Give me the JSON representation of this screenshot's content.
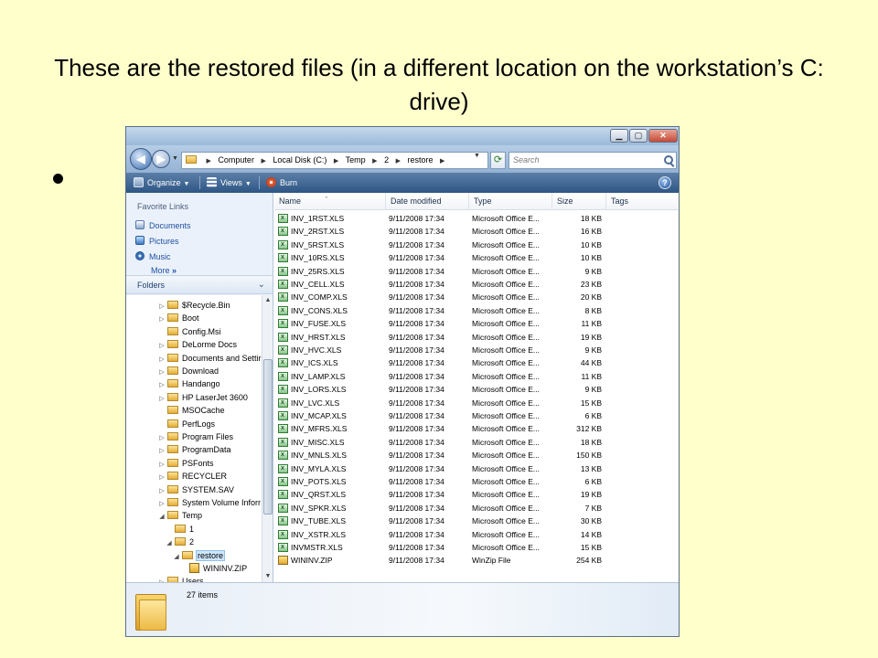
{
  "slide": {
    "title": "These are the restored files (in a different location on the workstation’s C: drive)"
  },
  "window": {
    "address": {
      "crumbs": [
        "Computer",
        "Local Disk (C:)",
        "Temp",
        "2",
        "restore"
      ]
    },
    "search_placeholder": "Search",
    "toolbar": {
      "organize": "Organize",
      "views": "Views",
      "burn": "Burn"
    },
    "nav": {
      "favorite_links_title": "Favorite Links",
      "favorites": [
        "Documents",
        "Pictures",
        "Music"
      ],
      "more_label": "More",
      "folders_title": "Folders",
      "tree": [
        {
          "label": "$Recycle.Bin",
          "level": 0,
          "expander": "▷"
        },
        {
          "label": "Boot",
          "level": 0,
          "expander": "▷"
        },
        {
          "label": "Config.Msi",
          "level": 0,
          "expander": ""
        },
        {
          "label": "DeLorme Docs",
          "level": 0,
          "expander": "▷"
        },
        {
          "label": "Documents and Settir",
          "level": 0,
          "expander": "▷"
        },
        {
          "label": "Download",
          "level": 0,
          "expander": "▷"
        },
        {
          "label": "Handango",
          "level": 0,
          "expander": "▷"
        },
        {
          "label": "HP LaserJet 3600",
          "level": 0,
          "expander": "▷"
        },
        {
          "label": "MSOCache",
          "level": 0,
          "expander": ""
        },
        {
          "label": "PerfLogs",
          "level": 0,
          "expander": ""
        },
        {
          "label": "Program Files",
          "level": 0,
          "expander": "▷"
        },
        {
          "label": "ProgramData",
          "level": 0,
          "expander": "▷"
        },
        {
          "label": "PSFonts",
          "level": 0,
          "expander": "▷"
        },
        {
          "label": "RECYCLER",
          "level": 0,
          "expander": "▷"
        },
        {
          "label": "SYSTEM.SAV",
          "level": 0,
          "expander": "▷"
        },
        {
          "label": "System Volume Inforr",
          "level": 0,
          "expander": "▷"
        },
        {
          "label": "Temp",
          "level": 0,
          "expander": "◢"
        },
        {
          "label": "1",
          "level": 1,
          "expander": ""
        },
        {
          "label": "2",
          "level": 1,
          "expander": "◢"
        },
        {
          "label": "restore",
          "level": 2,
          "expander": "◢",
          "selected": true
        },
        {
          "label": "WININV.ZIP",
          "level": 3,
          "expander": "",
          "zip": true
        },
        {
          "label": "Users",
          "level": 0,
          "expander": "▷"
        }
      ]
    },
    "columns": [
      "Name",
      "Date modified",
      "Type",
      "Size",
      "Tags"
    ],
    "files": [
      {
        "name": "INV_1RST.XLS",
        "date": "9/11/2008 17:34",
        "type": "Microsoft Office E...",
        "size": "18 KB"
      },
      {
        "name": "INV_2RST.XLS",
        "date": "9/11/2008 17:34",
        "type": "Microsoft Office E...",
        "size": "16 KB"
      },
      {
        "name": "INV_5RST.XLS",
        "date": "9/11/2008 17:34",
        "type": "Microsoft Office E...",
        "size": "10 KB"
      },
      {
        "name": "INV_10RS.XLS",
        "date": "9/11/2008 17:34",
        "type": "Microsoft Office E...",
        "size": "10 KB"
      },
      {
        "name": "INV_25RS.XLS",
        "date": "9/11/2008 17:34",
        "type": "Microsoft Office E...",
        "size": "9 KB"
      },
      {
        "name": "INV_CELL.XLS",
        "date": "9/11/2008 17:34",
        "type": "Microsoft Office E...",
        "size": "23 KB"
      },
      {
        "name": "INV_COMP.XLS",
        "date": "9/11/2008 17:34",
        "type": "Microsoft Office E...",
        "size": "20 KB"
      },
      {
        "name": "INV_CONS.XLS",
        "date": "9/11/2008 17:34",
        "type": "Microsoft Office E...",
        "size": "8 KB"
      },
      {
        "name": "INV_FUSE.XLS",
        "date": "9/11/2008 17:34",
        "type": "Microsoft Office E...",
        "size": "11 KB"
      },
      {
        "name": "INV_HRST.XLS",
        "date": "9/11/2008 17:34",
        "type": "Microsoft Office E...",
        "size": "19 KB"
      },
      {
        "name": "INV_HVC.XLS",
        "date": "9/11/2008 17:34",
        "type": "Microsoft Office E...",
        "size": "9 KB"
      },
      {
        "name": "INV_ICS.XLS",
        "date": "9/11/2008 17:34",
        "type": "Microsoft Office E...",
        "size": "44 KB"
      },
      {
        "name": "INV_LAMP.XLS",
        "date": "9/11/2008 17:34",
        "type": "Microsoft Office E...",
        "size": "11 KB"
      },
      {
        "name": "INV_LORS.XLS",
        "date": "9/11/2008 17:34",
        "type": "Microsoft Office E...",
        "size": "9 KB"
      },
      {
        "name": "INV_LVC.XLS",
        "date": "9/11/2008 17:34",
        "type": "Microsoft Office E...",
        "size": "15 KB"
      },
      {
        "name": "INV_MCAP.XLS",
        "date": "9/11/2008 17:34",
        "type": "Microsoft Office E...",
        "size": "6 KB"
      },
      {
        "name": "INV_MFRS.XLS",
        "date": "9/11/2008 17:34",
        "type": "Microsoft Office E...",
        "size": "312 KB"
      },
      {
        "name": "INV_MISC.XLS",
        "date": "9/11/2008 17:34",
        "type": "Microsoft Office E...",
        "size": "18 KB"
      },
      {
        "name": "INV_MNLS.XLS",
        "date": "9/11/2008 17:34",
        "type": "Microsoft Office E...",
        "size": "150 KB"
      },
      {
        "name": "INV_MYLA.XLS",
        "date": "9/11/2008 17:34",
        "type": "Microsoft Office E...",
        "size": "13 KB"
      },
      {
        "name": "INV_POTS.XLS",
        "date": "9/11/2008 17:34",
        "type": "Microsoft Office E...",
        "size": "6 KB"
      },
      {
        "name": "INV_QRST.XLS",
        "date": "9/11/2008 17:34",
        "type": "Microsoft Office E...",
        "size": "19 KB"
      },
      {
        "name": "INV_SPKR.XLS",
        "date": "9/11/2008 17:34",
        "type": "Microsoft Office E...",
        "size": "7 KB"
      },
      {
        "name": "INV_TUBE.XLS",
        "date": "9/11/2008 17:34",
        "type": "Microsoft Office E...",
        "size": "30 KB"
      },
      {
        "name": "INV_XSTR.XLS",
        "date": "9/11/2008 17:34",
        "type": "Microsoft Office E...",
        "size": "14 KB"
      },
      {
        "name": "INVMSTR.XLS",
        "date": "9/11/2008 17:34",
        "type": "Microsoft Office E...",
        "size": "15 KB"
      },
      {
        "name": "WININV.ZIP",
        "date": "9/11/2008 17:34",
        "type": "WinZip File",
        "size": "254 KB",
        "zip": true
      }
    ],
    "status": {
      "item_count": "27 items"
    }
  }
}
